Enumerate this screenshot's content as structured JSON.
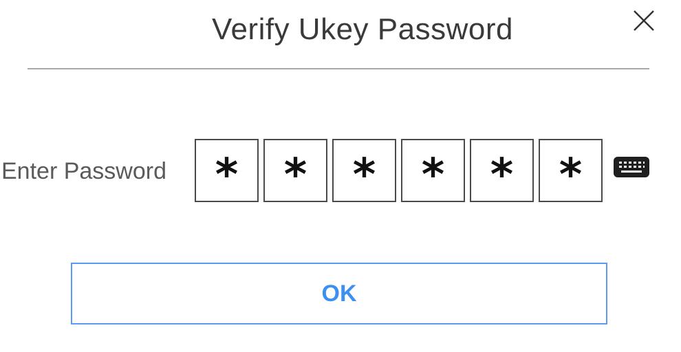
{
  "dialog": {
    "title": "Verify Ukey Password",
    "close_icon": "close-icon"
  },
  "password": {
    "label": "Enter Password",
    "masked_chars": [
      "*",
      "*",
      "*",
      "*",
      "*",
      "*"
    ],
    "keyboard_icon": "keyboard-icon"
  },
  "actions": {
    "ok_label": "OK"
  },
  "colors": {
    "accent": "#3d8ff0",
    "button_border": "#5b9cf0",
    "title_text": "#3a3a3a",
    "divider": "#a8a8a8"
  }
}
